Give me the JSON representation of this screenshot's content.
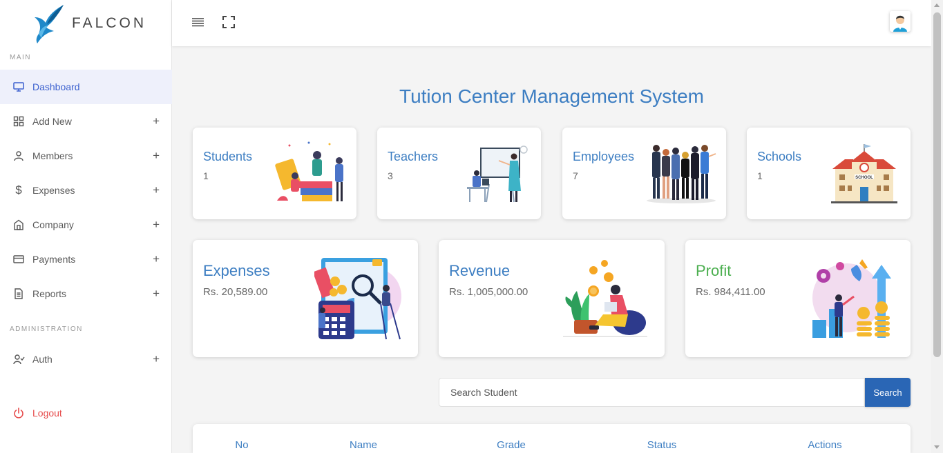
{
  "app": {
    "brand": "FALCON",
    "accent": "#3d7ec2",
    "active_bg": "#eef0fb"
  },
  "sidebar": {
    "section_main": "MAIN",
    "section_admin": "ADMINISTRATION",
    "items": [
      {
        "label": "Dashboard",
        "icon": "monitor-icon",
        "active": true
      },
      {
        "label": "Add New",
        "icon": "grid-icon"
      },
      {
        "label": "Members",
        "icon": "user-icon"
      },
      {
        "label": "Expenses",
        "icon": "dollar-icon"
      },
      {
        "label": "Company",
        "icon": "building-icon"
      },
      {
        "label": "Payments",
        "icon": "credit-card-icon"
      },
      {
        "label": "Reports",
        "icon": "document-icon"
      }
    ],
    "admin_items": [
      {
        "label": "Auth",
        "icon": "user-check-icon"
      }
    ],
    "logout": {
      "label": "Logout",
      "icon": "power-icon",
      "color": "#e64b4b"
    }
  },
  "page": {
    "title": "Tution Center Management System"
  },
  "stats": [
    {
      "title": "Students",
      "value": "1"
    },
    {
      "title": "Teachers",
      "value": "3"
    },
    {
      "title": "Employees",
      "value": "7"
    },
    {
      "title": "Schools",
      "value": "1"
    }
  ],
  "finance": [
    {
      "title": "Expenses",
      "value": "Rs. 20,589.00",
      "color": "#3d7ec2"
    },
    {
      "title": "Revenue",
      "value": "Rs. 1,005,000.00",
      "color": "#3d7ec2"
    },
    {
      "title": "Profit",
      "value": "Rs. 984,411.00",
      "color": "#4caf50"
    }
  ],
  "search": {
    "placeholder": "Search Student",
    "button": "Search"
  },
  "table": {
    "headers": [
      "No",
      "Name",
      "Grade",
      "Status",
      "Actions"
    ]
  }
}
